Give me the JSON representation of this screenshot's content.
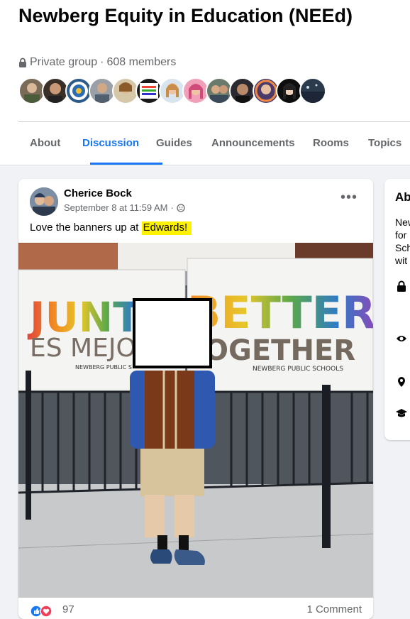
{
  "group": {
    "title": "Newberg Equity in Education (NEEd)",
    "privacy": "Private group",
    "separator": "·",
    "members": "608 members"
  },
  "tabs": [
    {
      "label": "About"
    },
    {
      "label": "Discussion",
      "active": true
    },
    {
      "label": "Guides"
    },
    {
      "label": "Announcements"
    },
    {
      "label": "Rooms"
    },
    {
      "label": "Topics"
    }
  ],
  "post": {
    "author": "Cherice Bock",
    "timestamp": "September 8 at 11:59 AM",
    "separator": "·",
    "text_before": "Love the banners up at ",
    "text_highlight": "Edwards!",
    "more_label": "•••",
    "photo": {
      "banner_left_top": "JUNTO",
      "banner_left_bottom": "ES MEJO",
      "banner_left_caption": "NEWBERG PUBLIC S",
      "banner_right_top": "BETTER",
      "banner_right_bottom": "OGETHER",
      "banner_right_caption": "NEWBERG PUBLIC SCHOOLS"
    },
    "reactions_count": "97",
    "comments_count": "1 Comment"
  },
  "sidebar": {
    "title": "Ab",
    "desc_lines": [
      "New",
      "for",
      "Sch",
      "wit"
    ]
  },
  "colors": {
    "accent": "#1877f2",
    "secondary_text": "#65676b",
    "highlight": "#fff200"
  }
}
